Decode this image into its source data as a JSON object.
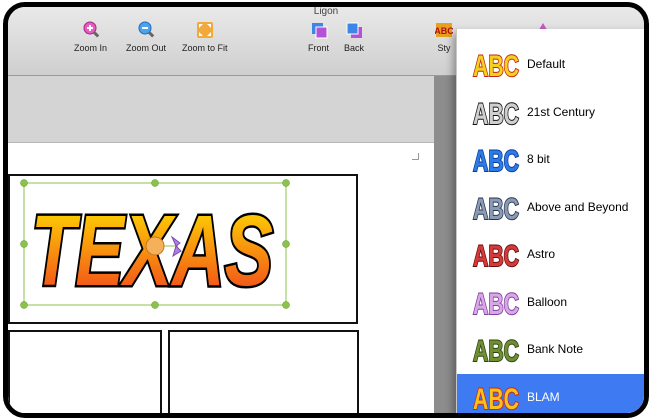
{
  "window": {
    "title": "Ligon"
  },
  "toolbar": {
    "zoom_in": "Zoom In",
    "zoom_out": "Zoom Out",
    "zoom_to_fit": "Zoom to Fit",
    "front": "Front",
    "back": "Back",
    "style": "Sty"
  },
  "canvas": {
    "title_art": {
      "text": "TEXAS"
    }
  },
  "style_menu": {
    "items": [
      {
        "label": "Default",
        "icon": "abc-default-style-icon"
      },
      {
        "label": "21st Century",
        "icon": "abc-21st-century-style-icon"
      },
      {
        "label": "8 bit",
        "icon": "abc-8-bit-style-icon"
      },
      {
        "label": "Above and Beyond",
        "icon": "abc-above-and-beyond-style-icon"
      },
      {
        "label": "Astro",
        "icon": "abc-astro-style-icon"
      },
      {
        "label": "Balloon",
        "icon": "abc-balloon-style-icon"
      },
      {
        "label": "Bank Note",
        "icon": "abc-bank-note-style-icon"
      },
      {
        "label": "BLAM",
        "icon": "abc-blam-style-icon"
      }
    ],
    "selected": "BLAM",
    "icon_text": "ABC"
  },
  "colors": {
    "selection_blue": "#3e7bf2",
    "handle_green": "#8bc34a",
    "title_gradient_top": "#ffe600",
    "title_gradient_bottom": "#f03a1e"
  }
}
